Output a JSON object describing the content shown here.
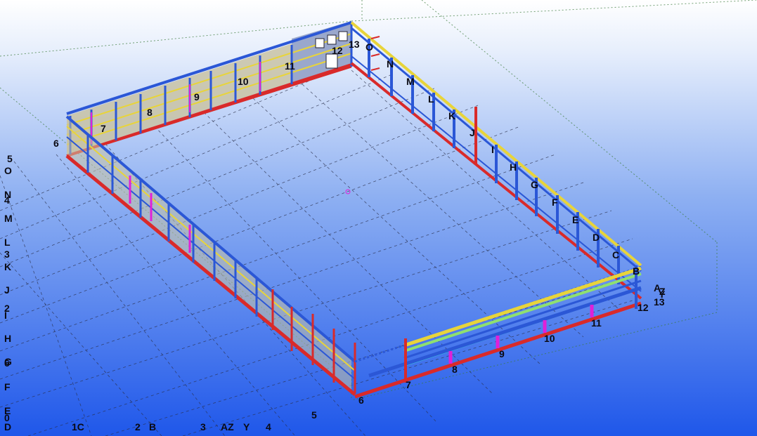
{
  "viewport": {
    "background_top": "#ffffff",
    "background_bottom": "#1f57ea",
    "grid_color": "#2a2f4a",
    "colors": {
      "column": "#2b57d6",
      "base_beam": "#d92a2a",
      "top_chord": "#e8d43a",
      "brace": "#e020d8",
      "rail": "#3cc8e0",
      "panel": "#c9c3a4"
    }
  },
  "far_wall_labels": [
    "6",
    "7",
    "8",
    "9",
    "10",
    "11",
    "12",
    "13",
    "O"
  ],
  "right_wall_labels": [
    "N",
    "M",
    "L",
    "K",
    "J",
    "I",
    "H",
    "G",
    "F",
    "E",
    "D",
    "C",
    "B"
  ],
  "front_right_labels": [
    "6",
    "7",
    "8",
    "9",
    "10",
    "11",
    "12",
    "13",
    "A",
    "Z",
    "Y"
  ],
  "left_grid_labels": [
    "5",
    "O",
    "N",
    "4",
    "M",
    "L",
    "3",
    "K",
    "J",
    "2",
    "I",
    "H",
    "G",
    "6",
    "F",
    "E",
    "0",
    "D"
  ],
  "bottom_grid_labels": [
    "1C",
    "2",
    "B",
    "3",
    "AZ",
    "Y",
    "4",
    "5"
  ]
}
